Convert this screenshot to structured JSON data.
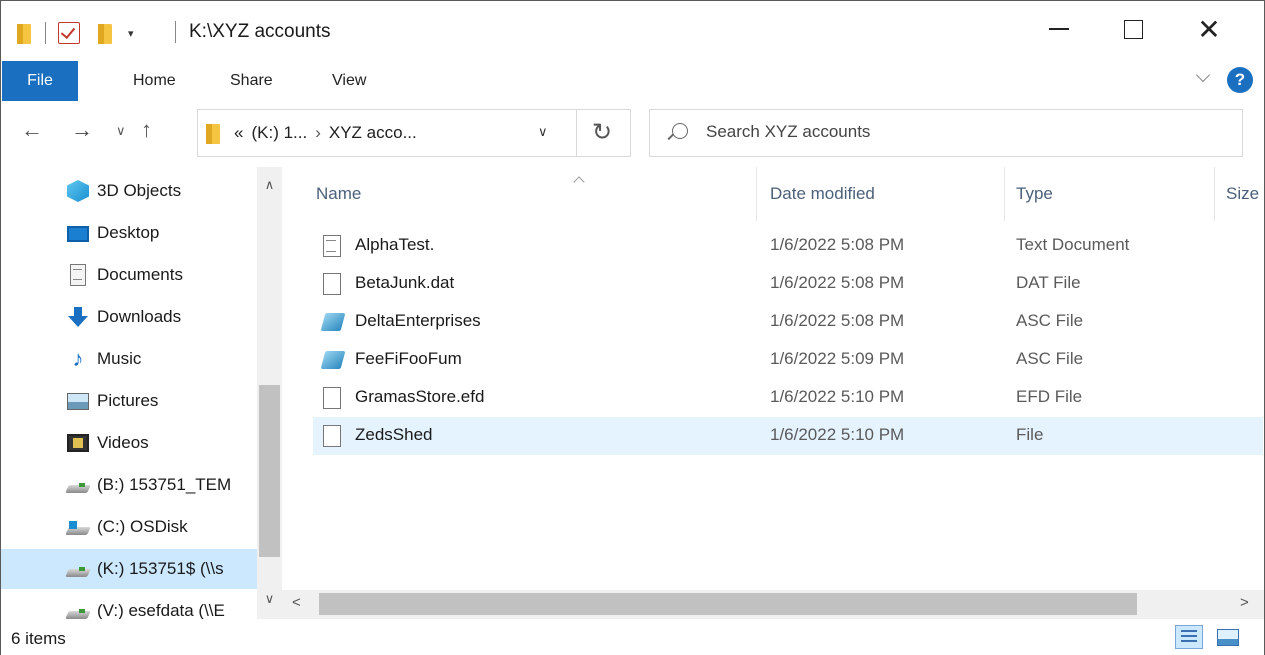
{
  "window": {
    "title": "K:\\XYZ accounts"
  },
  "ribbon": {
    "tabs": [
      {
        "label": "File"
      },
      {
        "label": "Home"
      },
      {
        "label": "Share"
      },
      {
        "label": "View"
      }
    ],
    "help_label": "?"
  },
  "address": {
    "crumb_prefix": "«",
    "crumbs": [
      "(K:) 1...",
      "XYZ acco..."
    ],
    "separator": "›"
  },
  "search": {
    "placeholder": "Search XYZ accounts",
    "value": ""
  },
  "navpane": {
    "items": [
      {
        "label": "3D Objects",
        "icon": "3d-objects-icon"
      },
      {
        "label": "Desktop",
        "icon": "desktop-icon"
      },
      {
        "label": "Documents",
        "icon": "documents-icon"
      },
      {
        "label": "Downloads",
        "icon": "downloads-icon"
      },
      {
        "label": "Music",
        "icon": "music-icon"
      },
      {
        "label": "Pictures",
        "icon": "pictures-icon"
      },
      {
        "label": "Videos",
        "icon": "videos-icon"
      },
      {
        "label": "(B:) 153751_TEM",
        "icon": "network-drive-icon"
      },
      {
        "label": "(C:) OSDisk",
        "icon": "os-drive-icon"
      },
      {
        "label": "(K:) 153751$ (\\\\s",
        "icon": "network-drive-icon",
        "selected": true
      },
      {
        "label": "(V:) esefdata (\\\\E",
        "icon": "network-drive-icon"
      }
    ]
  },
  "filelist": {
    "columns": [
      "Name",
      "Date modified",
      "Type",
      "Size"
    ],
    "rows": [
      {
        "name": "AlphaTest.",
        "date": "1/6/2022 5:08 PM",
        "type": "Text Document",
        "icon": "text-file-icon"
      },
      {
        "name": "BetaJunk.dat",
        "date": "1/6/2022 5:08 PM",
        "type": "DAT File",
        "icon": "blank-file-icon"
      },
      {
        "name": "DeltaEnterprises",
        "date": "1/6/2022 5:08 PM",
        "type": "ASC File",
        "icon": "asc-file-icon"
      },
      {
        "name": "FeeFiFooFum",
        "date": "1/6/2022 5:09 PM",
        "type": "ASC File",
        "icon": "asc-file-icon"
      },
      {
        "name": "GramasStore.efd",
        "date": "1/6/2022 5:10 PM",
        "type": "EFD File",
        "icon": "blank-file-icon"
      },
      {
        "name": "ZedsShed",
        "date": "1/6/2022 5:10 PM",
        "type": "File",
        "icon": "blank-file-icon",
        "selected": true
      }
    ]
  },
  "status": {
    "item_count": "6 items"
  },
  "colors": {
    "accent": "#1a6fc0",
    "selection": "#cce8ff",
    "hover_row": "#e5f3ff"
  }
}
